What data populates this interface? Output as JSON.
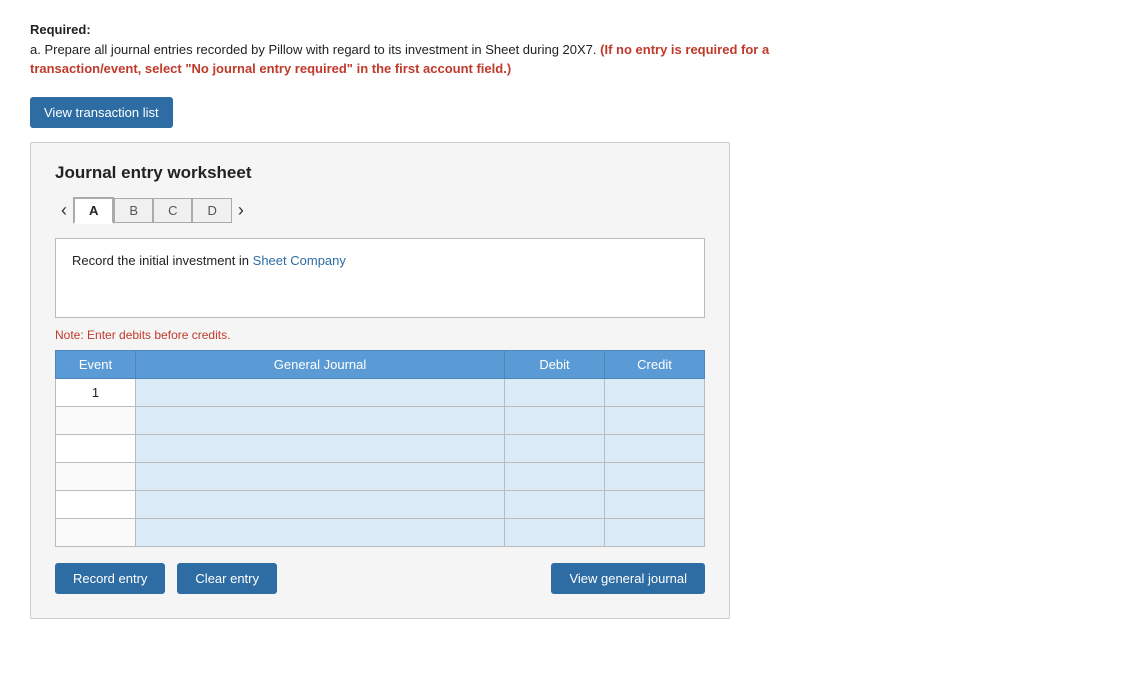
{
  "required": {
    "label": "Required:",
    "line1": "a. Prepare all journal entries recorded by Pillow with regard to its investment in Sheet during 20X7.",
    "bold_red": "(If no entry is required for a transaction/event, select \"No journal entry required\" in the first account field.)"
  },
  "view_transaction_btn": "View transaction list",
  "worksheet": {
    "title": "Journal entry worksheet",
    "tabs": [
      {
        "label": "A",
        "active": true
      },
      {
        "label": "B",
        "active": false
      },
      {
        "label": "C",
        "active": false
      },
      {
        "label": "D",
        "active": false
      }
    ],
    "description": "Record the initial investment in Sheet Company",
    "description_highlight": "Sheet Company",
    "note": "Note: Enter debits before credits.",
    "table": {
      "headers": [
        "Event",
        "General Journal",
        "Debit",
        "Credit"
      ],
      "rows": [
        {
          "event": "1",
          "journal": "",
          "debit": "",
          "credit": ""
        },
        {
          "event": "",
          "journal": "",
          "debit": "",
          "credit": ""
        },
        {
          "event": "",
          "journal": "",
          "debit": "",
          "credit": ""
        },
        {
          "event": "",
          "journal": "",
          "debit": "",
          "credit": ""
        },
        {
          "event": "",
          "journal": "",
          "debit": "",
          "credit": ""
        },
        {
          "event": "",
          "journal": "",
          "debit": "",
          "credit": ""
        }
      ]
    },
    "buttons": {
      "record": "Record entry",
      "clear": "Clear entry",
      "view_journal": "View general journal"
    }
  }
}
